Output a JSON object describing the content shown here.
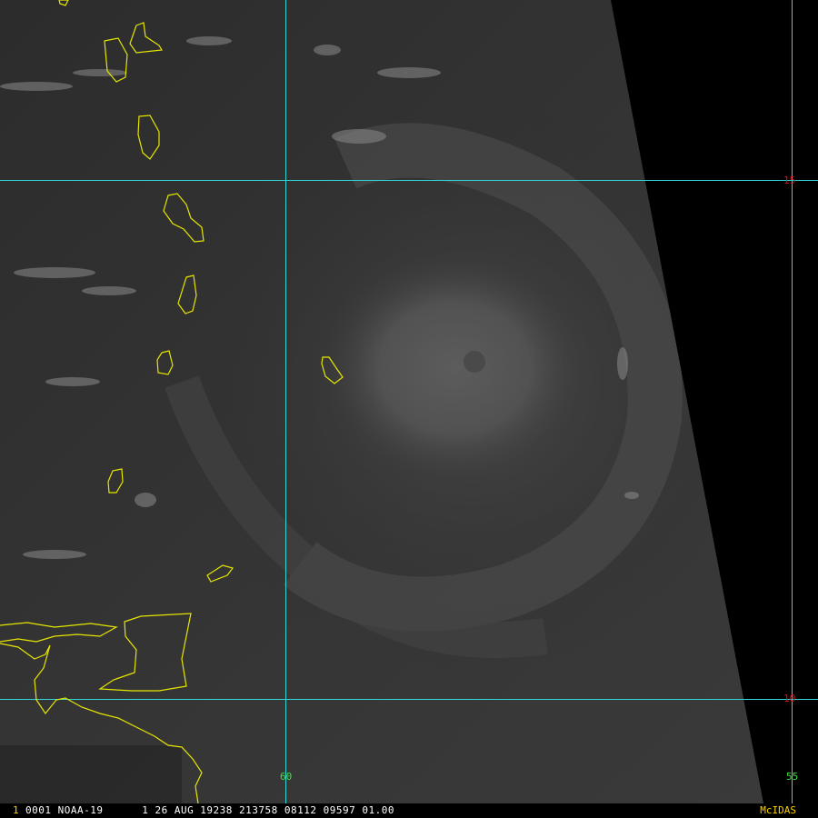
{
  "map": {
    "grid_color": "#33d6d6",
    "coast_color": "#e6e600",
    "lat_labels": [
      {
        "value": "15",
        "name": "lat-label-15"
      },
      {
        "value": "10",
        "name": "lat-label-10"
      }
    ],
    "lon_labels": [
      {
        "value": "60",
        "name": "lon-label-60"
      },
      {
        "value": "55",
        "name": "lon-label-55"
      }
    ]
  },
  "status": {
    "frame_number": "1",
    "text": "0001 NOAA-19      1 26 AUG 19238 213758 08112 09597 01.00",
    "brand": "McIDAS"
  }
}
